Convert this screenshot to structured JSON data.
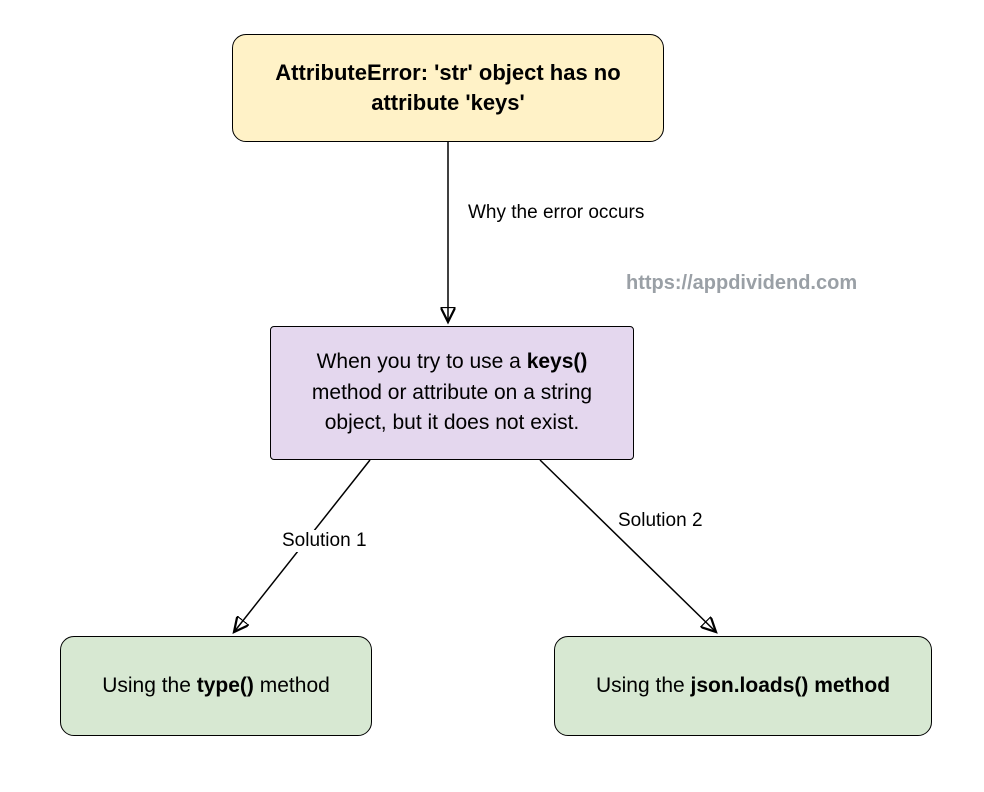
{
  "nodes": {
    "error_title": "AttributeError: 'str' object has no attribute 'keys'",
    "explanation_pre": "When you try to use a ",
    "explanation_bold": "keys()",
    "explanation_post": " method or attribute on a string object, but it does not exist.",
    "solution1_pre": "Using the ",
    "solution1_bold": "type()",
    "solution1_post": " method",
    "solution2_pre": "Using the ",
    "solution2_bold": "json.loads() method"
  },
  "edges": {
    "why": "Why the error occurs",
    "sol1": "Solution 1",
    "sol2": "Solution 2"
  },
  "watermark": "https://appdividend.com"
}
